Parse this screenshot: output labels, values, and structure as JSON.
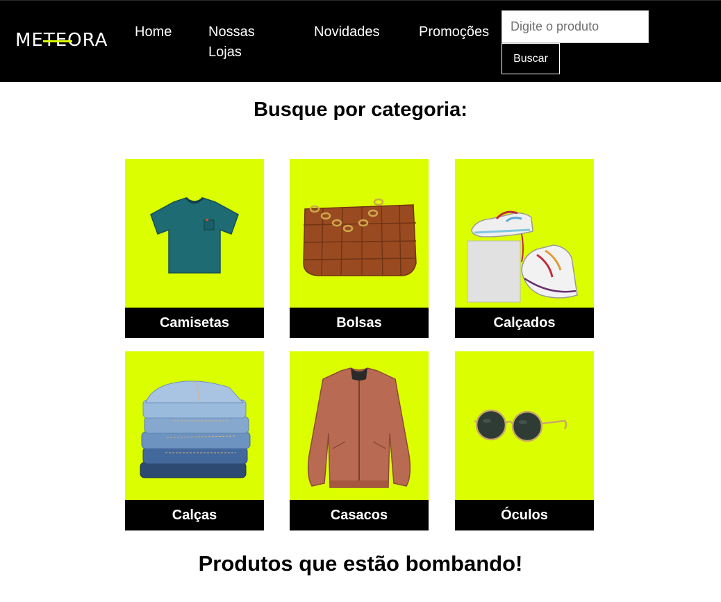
{
  "header": {
    "logo_text": "METEORA",
    "nav": {
      "home": "Home",
      "lojas": "Nossas Lojas",
      "novidades": "Novidades",
      "promocoes": "Promoções"
    },
    "search": {
      "placeholder": "Digite o produto",
      "button_label": "Buscar"
    }
  },
  "categories_section": {
    "title": "Busque por categoria:",
    "items": [
      {
        "label": "Camisetas",
        "icon": "tshirt-image"
      },
      {
        "label": "Bolsas",
        "icon": "handbag-image"
      },
      {
        "label": "Calçados",
        "icon": "sneakers-image"
      },
      {
        "label": "Calças",
        "icon": "jeans-stack-image"
      },
      {
        "label": "Casacos",
        "icon": "bomber-jacket-image"
      },
      {
        "label": "Óculos",
        "icon": "sunglasses-image"
      }
    ]
  },
  "trending_section": {
    "title": "Produtos que estão bombando!"
  },
  "colors": {
    "accent": "#dcff00",
    "header_bg": "#000000",
    "label_bg": "#000000"
  }
}
